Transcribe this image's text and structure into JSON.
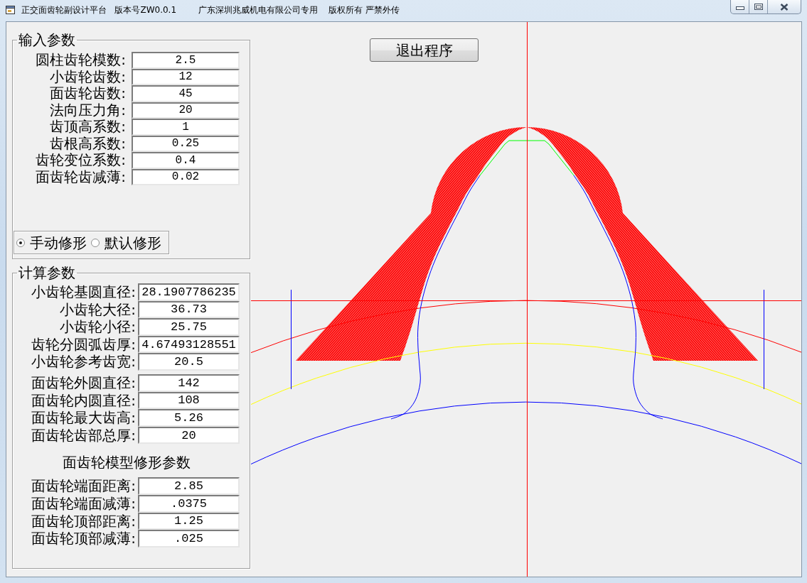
{
  "window": {
    "title": "正交面齿轮副设计平台   版本号ZW0.0.1        广东深圳兆威机电有限公司专用    版权所有 严禁外传"
  },
  "exit_button": {
    "label": "退出程序"
  },
  "input_parameters": {
    "title": "输入参数",
    "fields": [
      {
        "label": "圆柱齿轮模数:",
        "value": "2.5"
      },
      {
        "label": "小齿轮齿数:",
        "value": "12"
      },
      {
        "label": "面齿轮齿数:",
        "value": "45"
      },
      {
        "label": "法向压力角:",
        "value": "20"
      },
      {
        "label": "齿顶高系数:",
        "value": "1"
      },
      {
        "label": "齿根高系数:",
        "value": "0.25"
      },
      {
        "label": "齿轮变位系数:",
        "value": "0.4"
      },
      {
        "label": "面齿轮齿减薄:",
        "value": "0.02"
      }
    ]
  },
  "modification_mode": {
    "options": [
      {
        "label": "手动修形",
        "selected": true
      },
      {
        "label": "默认修形",
        "selected": false
      }
    ]
  },
  "calculated_parameters": {
    "title": "计算参数",
    "sections": [
      {
        "fields": [
          {
            "label": "小齿轮基圆直径:",
            "value": "28.1907786235"
          },
          {
            "label": "小齿轮大径:",
            "value": "36.73"
          },
          {
            "label": "小齿轮小径:",
            "value": "25.75"
          },
          {
            "label": "齿轮分圆弧齿厚:",
            "value": "4.67493128551"
          },
          {
            "label": "小齿轮参考齿宽:",
            "value": "20.5"
          }
        ]
      },
      {
        "fields": [
          {
            "label": "面齿轮外圆直径:",
            "value": "142"
          },
          {
            "label": "面齿轮内圆直径:",
            "value": "108"
          },
          {
            "label": "面齿轮最大齿高:",
            "value": "5.26"
          },
          {
            "label": "面齿轮齿部总厚:",
            "value": "20"
          }
        ]
      },
      {
        "heading": "面齿轮模型修形参数",
        "fields": [
          {
            "label": "面齿轮端面距离:",
            "value": "2.85"
          },
          {
            "label": "面齿轮端面减薄:",
            "value": ".0375"
          },
          {
            "label": "面齿轮顶部距离:",
            "value": "1.25"
          },
          {
            "label": "面齿轮顶部减薄:",
            "value": ".025"
          }
        ]
      }
    ]
  }
}
